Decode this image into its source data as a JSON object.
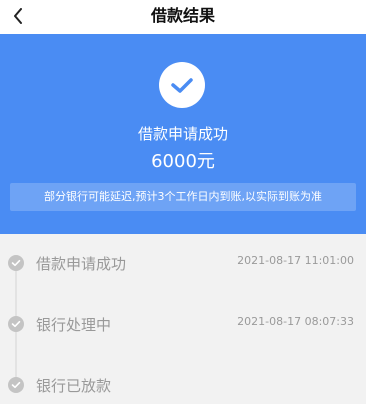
{
  "nav": {
    "back_icon": "chevron-left-icon",
    "title": "借款结果"
  },
  "hero": {
    "status_icon": "check-icon",
    "status_text": "借款申请成功",
    "amount": "6000元",
    "notice": "部分银行可能延迟,预计3个工作日内到账,以实际到账为准"
  },
  "timeline": {
    "steps": [
      {
        "label": "借款申请成功",
        "time": "2021-08-17 11:01:00"
      },
      {
        "label": "银行处理中",
        "time": "2021-08-17 08:07:33"
      },
      {
        "label": "银行已放款",
        "time": ""
      }
    ]
  },
  "colors": {
    "hero_background": "#4a8cf3",
    "notice_background": "#6ea3f5",
    "check_color": "#4a8cf3",
    "timeline_background": "#f2f2f2",
    "timeline_dot": "#c4c4c4",
    "timeline_text": "#999999"
  }
}
